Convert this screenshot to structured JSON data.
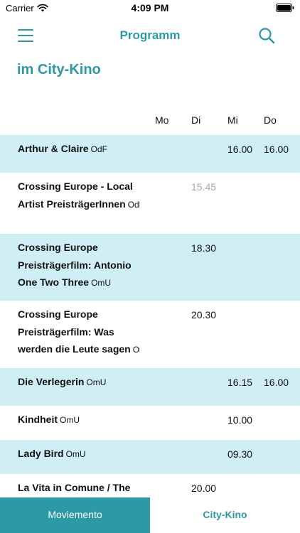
{
  "status": {
    "carrier": "Carrier",
    "time": "4:09 PM"
  },
  "nav": {
    "title": "Programm"
  },
  "heading": "im City-Kino",
  "days": [
    "Mo",
    "Di",
    "Mi",
    "Do"
  ],
  "rows": [
    {
      "lines": [
        "Arthur & Claire"
      ],
      "version": "OdF",
      "times": {
        "Di": "",
        "Mi": "16.00",
        "Do": "16.00"
      }
    },
    {
      "lines": [
        "Crossing Europe - Local",
        "Artist PreisträgerInnen"
      ],
      "version": "OdF",
      "times": {
        "Di": "15.45",
        "Mi": "",
        "Do": ""
      }
    },
    {
      "lines": [
        "Crossing Europe",
        "Preisträgerfilm: Antonio",
        "One Two Three"
      ],
      "version": "OmU",
      "times": {
        "Di": "18.30",
        "Mi": "",
        "Do": ""
      }
    },
    {
      "lines": [
        "Crossing Europe",
        "Preisträgerfilm: Was",
        "werden die Leute sagen"
      ],
      "version": "OmU",
      "times": {
        "Di": "20.30",
        "Mi": "",
        "Do": ""
      }
    },
    {
      "lines": [
        "Die Verlegerin"
      ],
      "version": "OmU",
      "times": {
        "Di": "",
        "Mi": "16.15",
        "Do": "16.00"
      }
    },
    {
      "lines": [
        "Kindheit"
      ],
      "version": "OmU",
      "times": {
        "Di": "",
        "Mi": "10.00",
        "Do": ""
      }
    },
    {
      "lines": [
        "Lady Bird"
      ],
      "version": "OmU",
      "times": {
        "Di": "",
        "Mi": "09.30",
        "Do": ""
      }
    },
    {
      "lines": [
        "La Vita in Comune / The"
      ],
      "version": "",
      "times": {
        "Di": "20.00",
        "Mi": "",
        "Do": ""
      }
    }
  ],
  "tabs": {
    "left": "Moviemento",
    "right": "City-Kino"
  },
  "colors": {
    "accent": "#2b9aa6",
    "row_highlight": "#d0eff4",
    "muted_time": "#a8a8a8"
  }
}
